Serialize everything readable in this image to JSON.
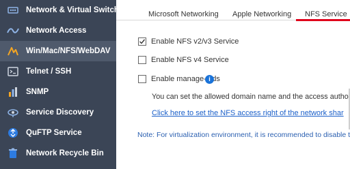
{
  "sidebar": {
    "items": [
      {
        "label": "Network & Virtual Switch",
        "icon": "network-switch-icon"
      },
      {
        "label": "Network Access",
        "icon": "network-access-icon"
      },
      {
        "label": "Win/Mac/NFS/WebDAV",
        "icon": "win-mac-nfs-icon",
        "active": true
      },
      {
        "label": "Telnet / SSH",
        "icon": "terminal-icon"
      },
      {
        "label": "SNMP",
        "icon": "snmp-icon"
      },
      {
        "label": "Service Discovery",
        "icon": "service-discovery-icon"
      },
      {
        "label": "QuFTP Service",
        "icon": "ftp-icon"
      },
      {
        "label": "Network Recycle Bin",
        "icon": "recycle-bin-icon"
      }
    ]
  },
  "tabs": [
    {
      "label": "Microsoft Networking"
    },
    {
      "label": "Apple Networking"
    },
    {
      "label": "NFS Service",
      "active": true
    }
  ],
  "options": [
    {
      "label": "Enable NFS v2/v3 Service",
      "checked": true
    },
    {
      "label": "Enable NFS v4 Service",
      "checked": false
    },
    {
      "label": "Enable manage-gids",
      "checked": false
    }
  ],
  "info_icon_glyph": "i",
  "description": "You can set the allowed domain name and the access authorit",
  "link_text": "Click here to set the NFS access right of the network shar",
  "note": "Note: For virtualization environment, it is recommended to disable t",
  "colors": {
    "sidebar_bg": "#3b4556",
    "sidebar_active": "#4f5a6c",
    "tab_active_underline": "#e0001b",
    "link": "#1a5fc9",
    "info": "#1a73d9"
  }
}
